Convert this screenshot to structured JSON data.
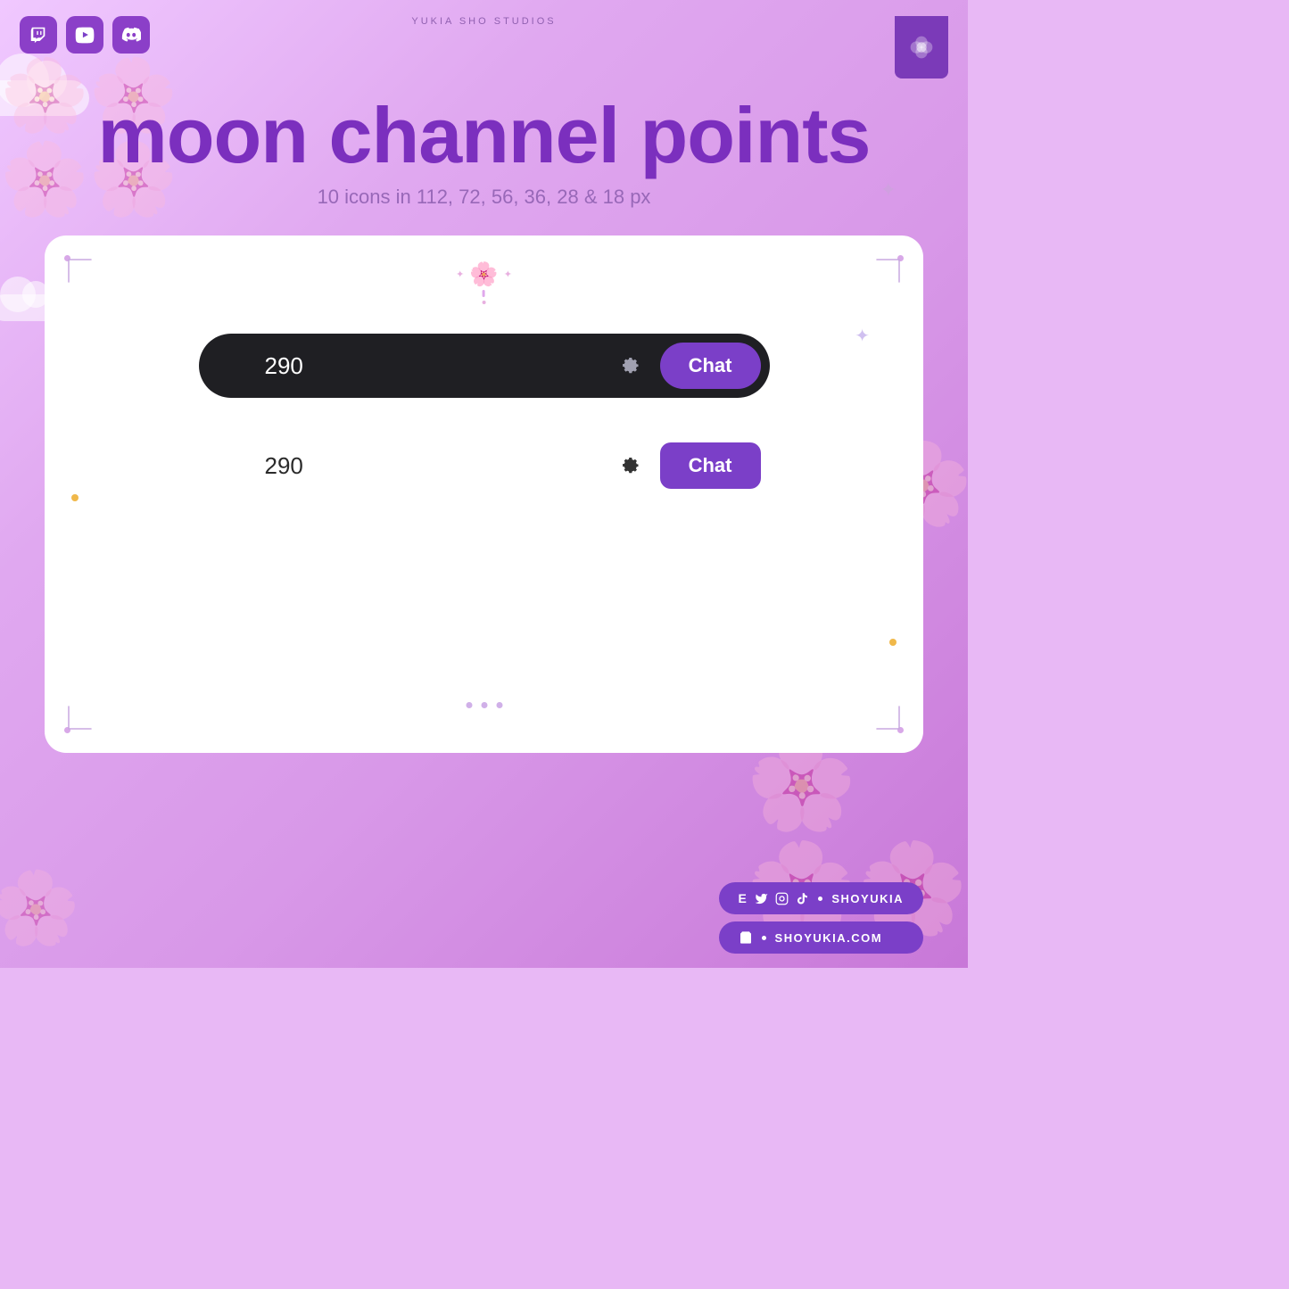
{
  "studio": {
    "name": "YUKIA SHO STUDIOS"
  },
  "header": {
    "title": "moon channel points",
    "subtitle": "10 icons in 112, 72, 56, 36, 28 & 18 px"
  },
  "social_top": {
    "twitch_label": "Twitch",
    "youtube_label": "YouTube",
    "discord_label": "Discord"
  },
  "mockup_dark": {
    "points": "290",
    "chat_label": "Chat",
    "gear_label": "Settings"
  },
  "mockup_light": {
    "points": "290",
    "chat_label": "Chat",
    "gear_label": "Settings"
  },
  "bottom_badge_social": {
    "label": "SHOYUKIA"
  },
  "bottom_badge_website": {
    "label": "SHOYUKIA.COM"
  }
}
